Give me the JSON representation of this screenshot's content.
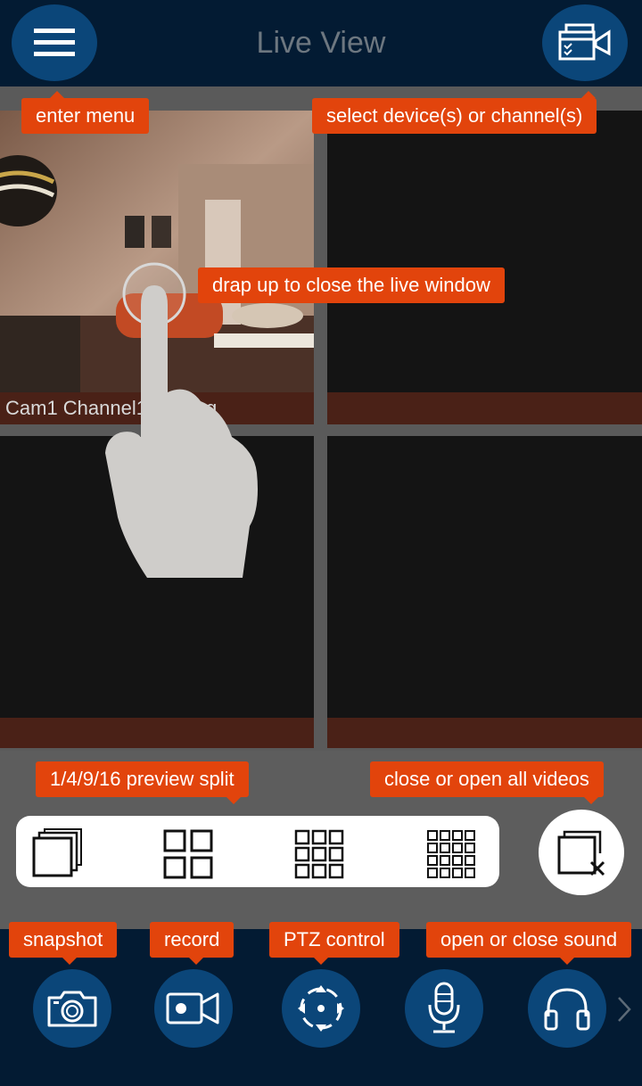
{
  "header": {
    "title": "Live View",
    "menu_icon": "hamburger-menu-icon",
    "device_icon": "select-device-icon"
  },
  "tiles": [
    {
      "label": "Cam1 Channel1 Playing"
    },
    {
      "label": ""
    },
    {
      "label": ""
    },
    {
      "label": ""
    }
  ],
  "tips": {
    "enter_menu": "enter menu",
    "select_devices": "select device(s) or channel(s)",
    "drag_close": "drap up to close the live window",
    "preview_split": "1/4/9/16 preview split",
    "close_open_videos": "close or open all videos",
    "snapshot": "snapshot",
    "record": "record",
    "ptz": "PTZ control",
    "sound": "open or close sound"
  },
  "split_options": [
    "1",
    "4",
    "9",
    "16"
  ],
  "toolbar": {
    "items": [
      "camera-icon",
      "video-record-icon",
      "ptz-icon",
      "microphone-icon",
      "headphones-icon"
    ],
    "next_icon": "chevron-right-icon"
  },
  "colors": {
    "header_bg": "#031b33",
    "button_bg": "#0b4679",
    "tip_bg": "#e2440c",
    "tile_bg": "#141414",
    "label_bar": "#4a2117"
  }
}
